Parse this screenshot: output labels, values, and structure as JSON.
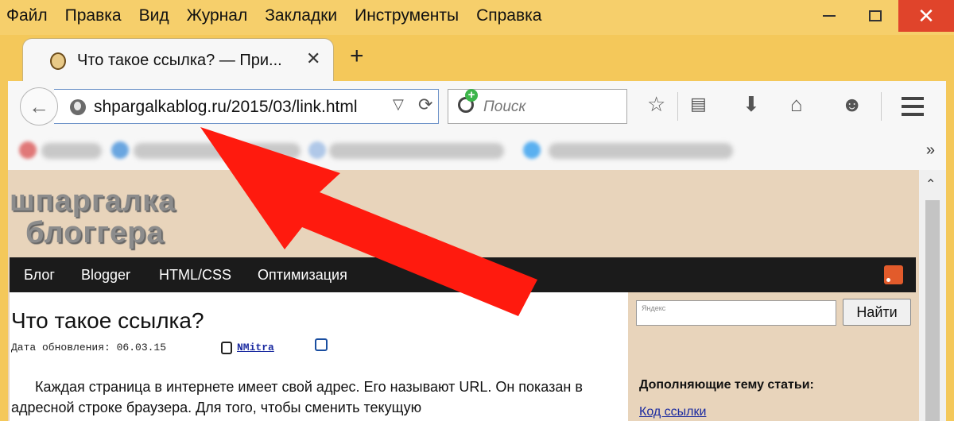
{
  "menubar": {
    "items": [
      {
        "label": "Файл"
      },
      {
        "label": "Правка"
      },
      {
        "label": "Вид"
      },
      {
        "label": "Журнал"
      },
      {
        "label": "Закладки"
      },
      {
        "label": "Инструменты"
      },
      {
        "label": "Справка"
      }
    ]
  },
  "tab": {
    "title": "Что такое ссылка? — При...",
    "close": "✕",
    "new_tab": "+"
  },
  "navbar": {
    "url": "shpargalkablog.ru/2015/03/link.html",
    "search_placeholder": "Поиск",
    "back_glyph": "←",
    "dropdown_glyph": "▽",
    "reload_glyph": "⟳",
    "icons": [
      "star-icon",
      "reading-list-icon",
      "download-icon",
      "home-icon",
      "smiley-icon",
      "menu-icon"
    ]
  },
  "bookmarks": {
    "more": "»"
  },
  "site": {
    "logo_line1": "шпаргалка",
    "logo_line2": "блоггера",
    "nav": [
      {
        "label": "Блог"
      },
      {
        "label": "Blogger"
      },
      {
        "label": "HTML/CSS"
      },
      {
        "label": "Оптимизация"
      }
    ]
  },
  "article": {
    "title": "Что такое ссылка?",
    "meta": "Дата обновления: 06.03.15",
    "author": "NMitra",
    "text": "Каждая страница в интернете имеет свой адрес. Его называют URL. Он показан в адресной строке браузера. Для того, чтобы сменить текущую"
  },
  "sidebar": {
    "search_placeholder": "Яндекс",
    "search_button": "Найти",
    "heading": "Дополняющие тему статьи:",
    "link": "Код ссылки"
  },
  "colors": {
    "frame": "#f4c85a",
    "close_button": "#e0442b",
    "site_bg": "#e8d4bb",
    "site_nav": "#1b1b1b",
    "arrow": "#ff1a0e"
  }
}
